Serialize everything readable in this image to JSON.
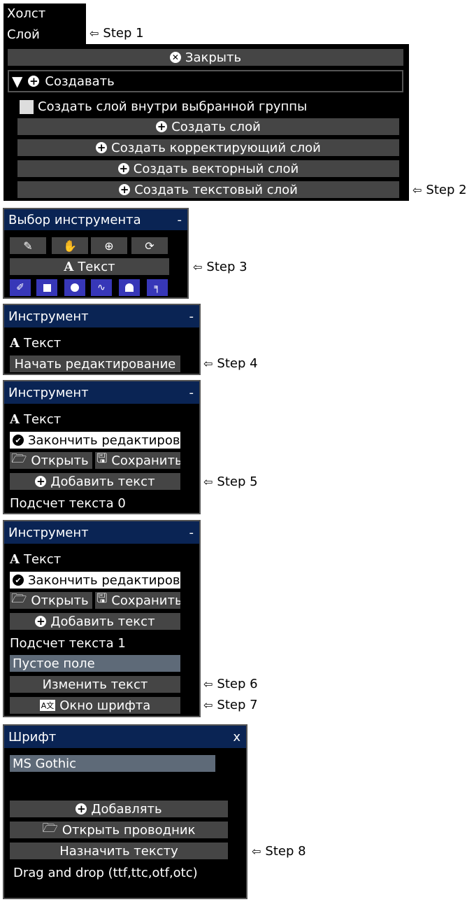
{
  "menu": {
    "items": [
      "Холст",
      "Слой"
    ]
  },
  "steps": [
    "Step 1",
    "Step 2",
    "Step 3",
    "Step 4",
    "Step 5",
    "Step 6",
    "Step 7",
    "Step 8"
  ],
  "layer_panel": {
    "close_label": "Закрыть",
    "create_section": "Создавать",
    "inside_group_label": "Создать слой внутри выбранной группы",
    "buttons": [
      "Создать слой",
      "Создать корректирующий слой",
      "Создать векторный слой",
      "Создать текстовый слой"
    ]
  },
  "tool_select": {
    "title": "Выбор инструмента",
    "collapse": "-",
    "text_tool_label": "Текст",
    "icons_row1": [
      "eyedropper-icon",
      "hand-icon",
      "zoom-icon",
      "refresh-icon"
    ],
    "icons_row2": [
      "pen-icon",
      "square-icon",
      "circle-icon",
      "brush-stroke-icon",
      "bell-icon",
      "paint-roller-icon"
    ]
  },
  "tool_panel_1": {
    "title": "Инструмент",
    "collapse": "-",
    "tool_name": "Текст",
    "start_edit": "Начать редактирование"
  },
  "tool_panel_2": {
    "title": "Инструмент",
    "collapse": "-",
    "tool_name": "Текст",
    "finish_edit": "Закончить редактиров",
    "open": "Открыть",
    "save": "Сохранить",
    "add_text": "Добавить текст",
    "count_label": "Подсчет текста 0"
  },
  "tool_panel_3": {
    "title": "Инструмент",
    "collapse": "-",
    "tool_name": "Текст",
    "finish_edit": "Закончить редактиров",
    "open": "Открыть",
    "save": "Сохранить",
    "add_text": "Добавить текст",
    "count_label": "Подсчет текста 1",
    "text_item": "Пустое поле",
    "change_text": "Изменить текст",
    "font_window": "Окно шрифта"
  },
  "font_panel": {
    "title": "Шрифт",
    "close": "x",
    "selected_font": "MS Gothic",
    "add": "Добавлять",
    "open_explorer": "Открыть проводник",
    "assign": "Назначить тексту",
    "hint": "Drag and drop (ttf,ttc,otf,otc)"
  }
}
